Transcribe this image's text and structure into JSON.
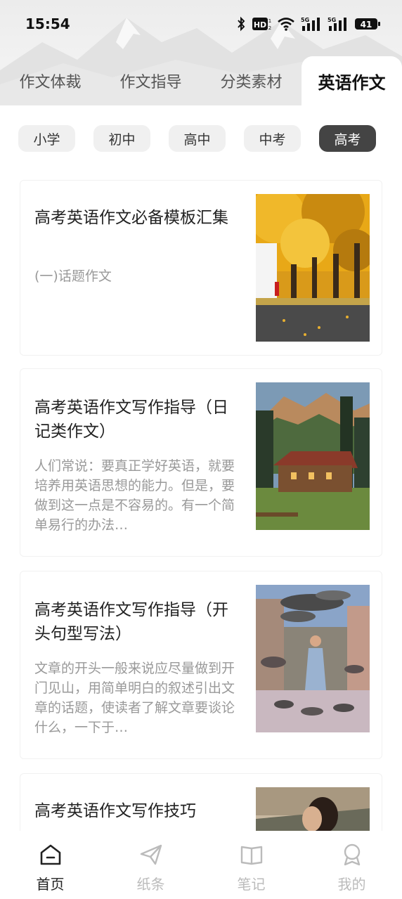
{
  "status_bar": {
    "time": "15:54",
    "battery": "41",
    "icons": [
      "bluetooth-icon",
      "hd-icon",
      "wifi-icon",
      "signal-5g-icon",
      "signal-5g-icon",
      "battery-icon"
    ]
  },
  "top_tabs": [
    {
      "label": "作文体裁",
      "active": false
    },
    {
      "label": "作文指导",
      "active": false
    },
    {
      "label": "分类素材",
      "active": false
    },
    {
      "label": "英语作文",
      "active": true
    }
  ],
  "level_chips": [
    {
      "label": "小学",
      "active": false
    },
    {
      "label": "初中",
      "active": false
    },
    {
      "label": "高中",
      "active": false
    },
    {
      "label": "中考",
      "active": false
    },
    {
      "label": "高考",
      "active": true
    }
  ],
  "articles": [
    {
      "title": "高考英语作文必备模板汇集",
      "desc": "(一)话题作文",
      "image": "autumn-trees-street-photo"
    },
    {
      "title": "高考英语作文写作指导（日记类作文）",
      "desc": "人们常说：要真正学好英语，就要培养用英语思想的能力。但是，要做到这一点是不容易的。有一个简单易行的办法…",
      "image": "forest-cabin-photo"
    },
    {
      "title": "高考英语作文写作指导（开头句型写法）",
      "desc": "文章的开头一般来说应尽量做到开门见山，用简单明白的叙述引出文章的话题，使读者了解文章要谈论什么，一下于…",
      "image": "woman-with-pigeons-photo"
    },
    {
      "title": "高考英语作文写作技巧",
      "desc": "",
      "image": "woman-portrait-photo"
    }
  ],
  "bottom_nav": [
    {
      "label": "首页",
      "icon": "home-icon",
      "active": true
    },
    {
      "label": "纸条",
      "icon": "paper-plane-icon",
      "active": false
    },
    {
      "label": "笔记",
      "icon": "book-icon",
      "active": false
    },
    {
      "label": "我的",
      "icon": "profile-icon",
      "active": false
    }
  ],
  "colors": {
    "active_chip_bg": "#444444",
    "inactive_text": "#bbbbbb",
    "desc_text": "#999999"
  }
}
